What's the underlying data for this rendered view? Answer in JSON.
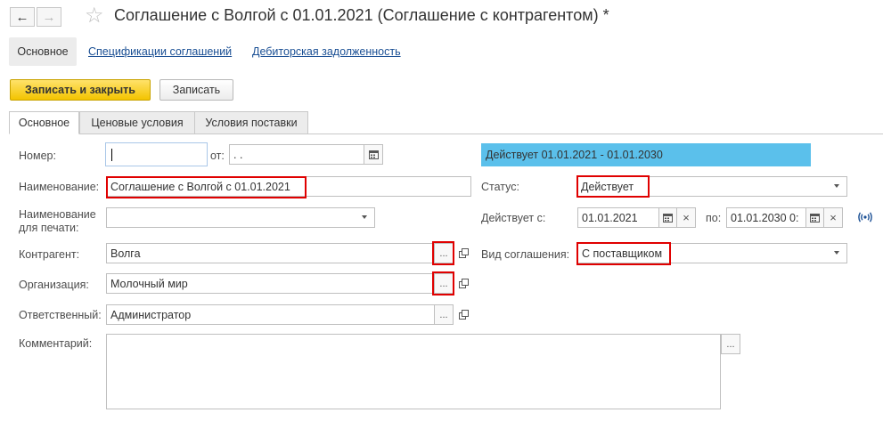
{
  "header": {
    "back_glyph": "←",
    "forward_glyph": "→",
    "star_glyph": "☆",
    "title": "Соглашение с Волгой с 01.01.2021 (Соглашение с контрагентом) *"
  },
  "topnav": {
    "active": "Основное",
    "links": [
      "Спецификации соглашений",
      "Дебиторская задолженность"
    ]
  },
  "commands": {
    "save_close": "Записать и закрыть",
    "save": "Записать"
  },
  "tabs": [
    "Основное",
    "Ценовые условия",
    "Условия поставки"
  ],
  "form": {
    "number": {
      "label": "Номер:",
      "value": ""
    },
    "date_from": {
      "label": "от:",
      "value": "  .  ."
    },
    "name": {
      "label": "Наименование:",
      "value": "Соглашение с Волгой с 01.01.2021"
    },
    "print_name": {
      "label1": "Наименование",
      "label2": "для печати:",
      "value": ""
    },
    "counterparty": {
      "label": "Контрагент:",
      "value": "Волга"
    },
    "organization": {
      "label": "Организация:",
      "value": "Молочный мир"
    },
    "responsible": {
      "label": "Ответственный:",
      "value": "Администратор"
    },
    "comment": {
      "label": "Комментарий:",
      "value": ""
    },
    "status_banner": "Действует 01.01.2021 - 01.01.2030",
    "status": {
      "label": "Статус:",
      "value": "Действует"
    },
    "valid_from": {
      "label": "Действует с:",
      "value": "01.01.2021"
    },
    "valid_to": {
      "label": "по:",
      "value": "01.01.2030  0:"
    },
    "agreement_type": {
      "label": "Вид соглашения:",
      "value": "С поставщиком"
    },
    "ellipsis": "...",
    "clear_glyph": "×"
  },
  "colors": {
    "accent_yellow": "#f3c400",
    "status_banner": "#5bc0eb",
    "highlight_red": "#e00000",
    "link_blue": "#1a4f94"
  }
}
